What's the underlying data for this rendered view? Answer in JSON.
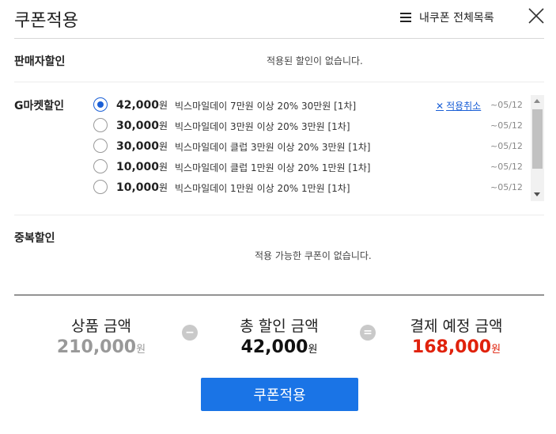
{
  "header": {
    "title": "쿠폰적용",
    "my_coupons_label": "내쿠폰 전체목록",
    "close_icon": "close-icon"
  },
  "seller_discount": {
    "label": "판매자할인",
    "empty_message": "적용된 할인이 없습니다."
  },
  "gmarket_discount": {
    "label": "G마켓할인",
    "cancel_label": "적용취소",
    "won_suffix": "원",
    "coupons": [
      {
        "amount": "42,000",
        "desc": "빅스마일데이 7만원 이상 20% 30만원 [1차]",
        "date": "~05/12",
        "selected": true
      },
      {
        "amount": "30,000",
        "desc": "빅스마일데이 3만원 이상 20% 3만원 [1차]",
        "date": "~05/12",
        "selected": false
      },
      {
        "amount": "30,000",
        "desc": "빅스마일데이 클럽 3만원 이상 20% 3만원 [1차]",
        "date": "~05/12",
        "selected": false
      },
      {
        "amount": "10,000",
        "desc": "빅스마일데이 클럽 1만원 이상 20% 1만원 [1차]",
        "date": "~05/12",
        "selected": false
      },
      {
        "amount": "10,000",
        "desc": "빅스마일데이 1만원 이상 20% 1만원 [1차]",
        "date": "~05/12",
        "selected": false
      }
    ]
  },
  "duplicate_discount": {
    "label": "중복할인",
    "empty_message": "적용 가능한 쿠폰이 없습니다."
  },
  "summary": {
    "product_label": "상품 금액",
    "product_value": "210,000",
    "minus_symbol": "−",
    "discount_label": "총 할인 금액",
    "discount_value": "42,000",
    "equals_symbol": "=",
    "payment_label": "결제 예정 금액",
    "payment_value": "168,000",
    "won": "원"
  },
  "apply_button": "쿠폰적용",
  "colors": {
    "accent_blue": "#1a74e6",
    "total_red": "#e0220c",
    "product_gray": "#999999"
  }
}
